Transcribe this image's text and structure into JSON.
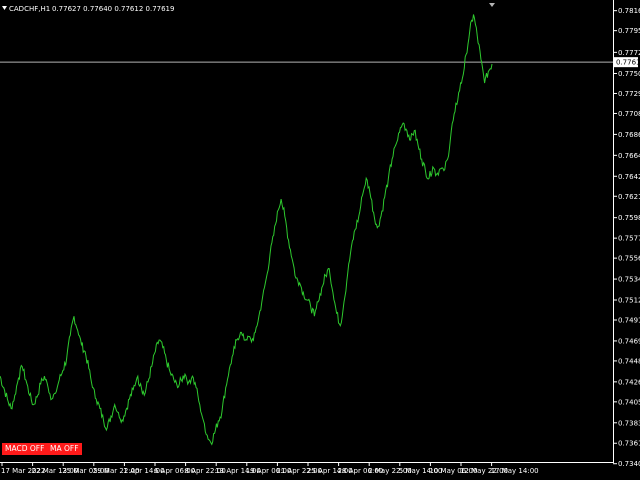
{
  "header": {
    "symbol": "CADCHF,H1",
    "ohlc": "0.77627 0.77640 0.77612 0.77619"
  },
  "buttons": {
    "macd": "MACD OFF",
    "ma": "MA OFF"
  },
  "colors": {
    "background": "#000000",
    "series": "#2ec92e",
    "price_line": "#b4b4b4",
    "axis": "#ffffff",
    "button": "#ff1a1a"
  },
  "chart_data": {
    "type": "line",
    "title": "CADCHF,H1",
    "ylim": [
      0.7346,
      0.7823
    ],
    "current_price_label": "0.77619",
    "y_ticks": [
      "0.78160",
      "0.77950",
      "0.77722",
      "0.77500",
      "0.77290",
      "0.77080",
      "0.76860",
      "0.76640",
      "0.76420",
      "0.76210",
      "0.75985",
      "0.75770",
      "0.75560",
      "0.75340",
      "0.75120",
      "0.74910",
      "0.74690",
      "0.74480",
      "0.74260",
      "0.74050",
      "0.73830",
      "0.73615",
      "0.73400"
    ],
    "x_ticks": [
      "17 Mar 2022",
      "22 Mar 13:00",
      "25 Mar 05:00",
      "29 Mar 22:00",
      "1 Apr 14:00",
      "6 Apr 06:00",
      "8 Apr 22:00",
      "13 Apr 14:00",
      "19 Apr 06:00",
      "21 Apr 22:00",
      "25 Apr 14:00",
      "28 Apr 06:00",
      "2 May 22:00",
      "5 May 14:00",
      "10 May 06:00",
      "12 May 22:00",
      "17 May 14:00"
    ],
    "series": [
      {
        "values": [
          0.7432,
          0.742,
          0.7408,
          0.7398,
          0.7412,
          0.743,
          0.7442,
          0.7428,
          0.7412,
          0.7402,
          0.741,
          0.7424,
          0.7432,
          0.742,
          0.7408,
          0.7414,
          0.7428,
          0.7438,
          0.745,
          0.7475,
          0.7495,
          0.748,
          0.7465,
          0.7458,
          0.744,
          0.742,
          0.7408,
          0.7398,
          0.7385,
          0.7378,
          0.739,
          0.7402,
          0.7394,
          0.7386,
          0.7396,
          0.7408,
          0.7418,
          0.743,
          0.7424,
          0.7412,
          0.7426,
          0.7442,
          0.7458,
          0.747,
          0.7462,
          0.7448,
          0.7436,
          0.7428,
          0.742,
          0.7428,
          0.7434,
          0.7426,
          0.7432,
          0.742,
          0.7402,
          0.7385,
          0.737,
          0.7362,
          0.7372,
          0.7385,
          0.7395,
          0.742,
          0.744,
          0.7455,
          0.747,
          0.7478,
          0.747,
          0.7474,
          0.7468,
          0.7478,
          0.7495,
          0.7515,
          0.7535,
          0.756,
          0.758,
          0.7605,
          0.7618,
          0.76,
          0.7575,
          0.7555,
          0.7535,
          0.753,
          0.752,
          0.7512,
          0.7505,
          0.7495,
          0.751,
          0.7525,
          0.7538,
          0.7545,
          0.752,
          0.7498,
          0.7485,
          0.751,
          0.754,
          0.7568,
          0.7586,
          0.76,
          0.7622,
          0.764,
          0.7625,
          0.7604,
          0.7588,
          0.76,
          0.762,
          0.764,
          0.766,
          0.7675,
          0.7688,
          0.7698,
          0.769,
          0.768,
          0.769,
          0.7675,
          0.766,
          0.7648,
          0.764,
          0.7652,
          0.7644,
          0.765,
          0.7648,
          0.766,
          0.769,
          0.771,
          0.773,
          0.7745,
          0.777,
          0.7795,
          0.7812,
          0.779,
          0.7765,
          0.774,
          0.7752,
          0.776
        ]
      }
    ],
    "grid": false,
    "legend": "none"
  }
}
